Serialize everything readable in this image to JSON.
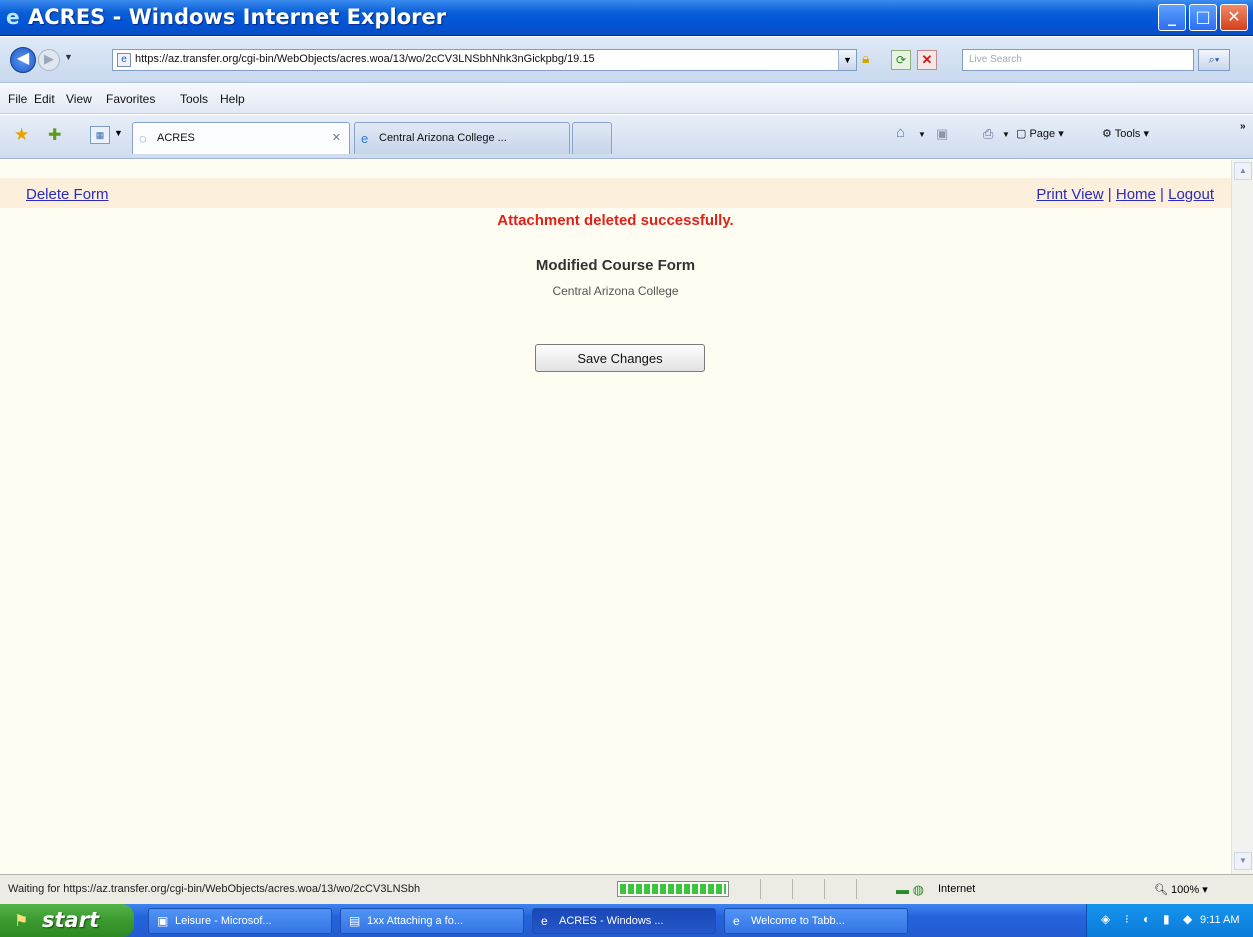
{
  "window": {
    "title": "ACRES - Windows Internet Explorer"
  },
  "address": {
    "url": "https://az.transfer.org/cgi-bin/WebObjects/acres.woa/13/wo/2cCV3LNSbhNhk3nGickpbg/19.15",
    "search_placeholder": "Live Search"
  },
  "menu": {
    "items": [
      "File",
      "Edit",
      "View",
      "Favorites",
      "Tools",
      "Help"
    ]
  },
  "tabs": [
    {
      "label": "ACRES",
      "active": true
    },
    {
      "label": "Central Arizona College ...",
      "active": false
    }
  ],
  "commands": {
    "page": "Page ▾",
    "tools": "Tools ▾"
  },
  "page": {
    "delete_form": "Delete Form",
    "print_view": "Print View",
    "home": "Home",
    "logout": "Logout",
    "message": "Attachment deleted successfully.",
    "form_title": "Modified Course Form",
    "college": "Central Arizona College",
    "save_button": "Save Changes"
  },
  "status": {
    "text": "Waiting for https://az.transfer.org/cgi-bin/WebObjects/acres.woa/13/wo/2cCV3LNSbh",
    "zone": "Internet",
    "zoom": "100%"
  },
  "taskbar": {
    "start": "start",
    "items": [
      {
        "label": "Leisure - Microsof...",
        "active": false
      },
      {
        "label": "1xx Attaching a fo...",
        "active": false
      },
      {
        "label": "ACRES - Windows ...",
        "active": true
      },
      {
        "label": "Welcome to Tabb...",
        "active": false
      }
    ],
    "clock": "9:11 AM"
  },
  "colors": {
    "message": "#e0211a",
    "link": "#2b2bbd",
    "content_bg": "#fffdf1",
    "topbar_bg": "#fcefdc"
  }
}
